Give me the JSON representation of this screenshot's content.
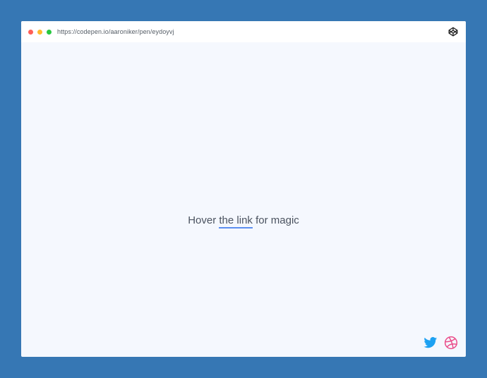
{
  "browser": {
    "url": "https://codepen.io/aaroniker/pen/eydoyvj",
    "traffic_lights": [
      "close",
      "minimize",
      "maximize"
    ],
    "toolbar_icon": "codepen-icon"
  },
  "main": {
    "text_before": "Hover",
    "link_text": "the link",
    "text_after": "for magic",
    "link_underline_color": "#5b8ef0"
  },
  "social": {
    "twitter_icon": "twitter-icon",
    "dribbble_icon": "dribbble-icon"
  },
  "colors": {
    "page_background": "#3677b4",
    "window_background": "#f5f8fe",
    "text": "#4b5360",
    "twitter": "#1da1f2",
    "dribbble": "#ea4c89"
  }
}
